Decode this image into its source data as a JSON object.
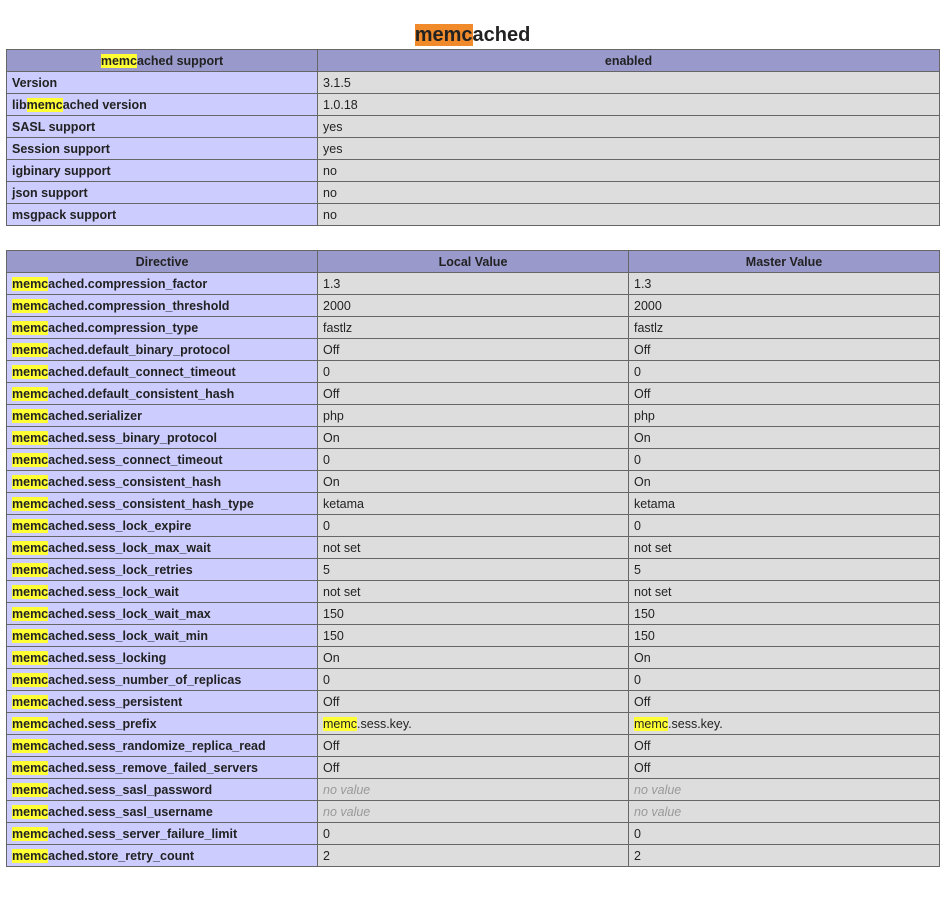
{
  "title": {
    "highlight": "memc",
    "rest": "ached"
  },
  "support_table": {
    "header": {
      "key_hl": "memc",
      "key_rest": "ached support",
      "value": "enabled"
    },
    "rows": [
      {
        "pre": "",
        "hl": "",
        "post": "Version",
        "value": "3.1.5"
      },
      {
        "pre": "lib",
        "hl": "memc",
        "post": "ached version",
        "value": "1.0.18"
      },
      {
        "pre": "",
        "hl": "",
        "post": "SASL support",
        "value": "yes"
      },
      {
        "pre": "",
        "hl": "",
        "post": "Session support",
        "value": "yes"
      },
      {
        "pre": "",
        "hl": "",
        "post": "igbinary support",
        "value": "no"
      },
      {
        "pre": "",
        "hl": "",
        "post": "json support",
        "value": "no"
      },
      {
        "pre": "",
        "hl": "",
        "post": "msgpack support",
        "value": "no"
      }
    ]
  },
  "directive_table": {
    "headers": {
      "directive": "Directive",
      "local": "Local Value",
      "master": "Master Value"
    },
    "prefix_hl": "memc",
    "rows": [
      {
        "name": "ached.compression_factor",
        "local": "1.3",
        "master": "1.3"
      },
      {
        "name": "ached.compression_threshold",
        "local": "2000",
        "master": "2000"
      },
      {
        "name": "ached.compression_type",
        "local": "fastlz",
        "master": "fastlz"
      },
      {
        "name": "ached.default_binary_protocol",
        "local": "Off",
        "master": "Off"
      },
      {
        "name": "ached.default_connect_timeout",
        "local": "0",
        "master": "0"
      },
      {
        "name": "ached.default_consistent_hash",
        "local": "Off",
        "master": "Off"
      },
      {
        "name": "ached.serializer",
        "local": "php",
        "master": "php"
      },
      {
        "name": "ached.sess_binary_protocol",
        "local": "On",
        "master": "On"
      },
      {
        "name": "ached.sess_connect_timeout",
        "local": "0",
        "master": "0"
      },
      {
        "name": "ached.sess_consistent_hash",
        "local": "On",
        "master": "On"
      },
      {
        "name": "ached.sess_consistent_hash_type",
        "local": "ketama",
        "master": "ketama"
      },
      {
        "name": "ached.sess_lock_expire",
        "local": "0",
        "master": "0"
      },
      {
        "name": "ached.sess_lock_max_wait",
        "local": "not set",
        "master": "not set"
      },
      {
        "name": "ached.sess_lock_retries",
        "local": "5",
        "master": "5"
      },
      {
        "name": "ached.sess_lock_wait",
        "local": "not set",
        "master": "not set"
      },
      {
        "name": "ached.sess_lock_wait_max",
        "local": "150",
        "master": "150"
      },
      {
        "name": "ached.sess_lock_wait_min",
        "local": "150",
        "master": "150"
      },
      {
        "name": "ached.sess_locking",
        "local": "On",
        "master": "On"
      },
      {
        "name": "ached.sess_number_of_replicas",
        "local": "0",
        "master": "0"
      },
      {
        "name": "ached.sess_persistent",
        "local": "Off",
        "master": "Off"
      },
      {
        "name": "ached.sess_prefix",
        "local_hl": "memc",
        "local": ".sess.key.",
        "master_hl": "memc",
        "master": ".sess.key."
      },
      {
        "name": "ached.sess_randomize_replica_read",
        "local": "Off",
        "master": "Off"
      },
      {
        "name": "ached.sess_remove_failed_servers",
        "local": "Off",
        "master": "Off"
      },
      {
        "name": "ached.sess_sasl_password",
        "local": "no value",
        "master": "no value",
        "novalue": true
      },
      {
        "name": "ached.sess_sasl_username",
        "local": "no value",
        "master": "no value",
        "novalue": true
      },
      {
        "name": "ached.sess_server_failure_limit",
        "local": "0",
        "master": "0"
      },
      {
        "name": "ached.store_retry_count",
        "local": "2",
        "master": "2"
      }
    ]
  },
  "colors": {
    "header_bg": "#9999cc",
    "key_bg": "#ccccff",
    "value_bg": "#dddddd",
    "search_highlight": "#ffff33",
    "title_highlight": "#f08a2a"
  }
}
